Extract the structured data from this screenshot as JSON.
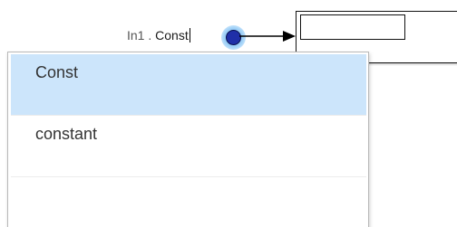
{
  "port": {
    "prefix": "In1 . ",
    "typed": "Const"
  },
  "autocomplete": {
    "items": [
      {
        "label": "Const",
        "selected": true
      },
      {
        "label": "constant",
        "selected": false
      },
      {
        "label": "",
        "selected": false
      }
    ]
  },
  "colors": {
    "selection": "#cce5fb",
    "port_dot": "#1f2fa8",
    "port_glow": "#5aaaf0"
  }
}
